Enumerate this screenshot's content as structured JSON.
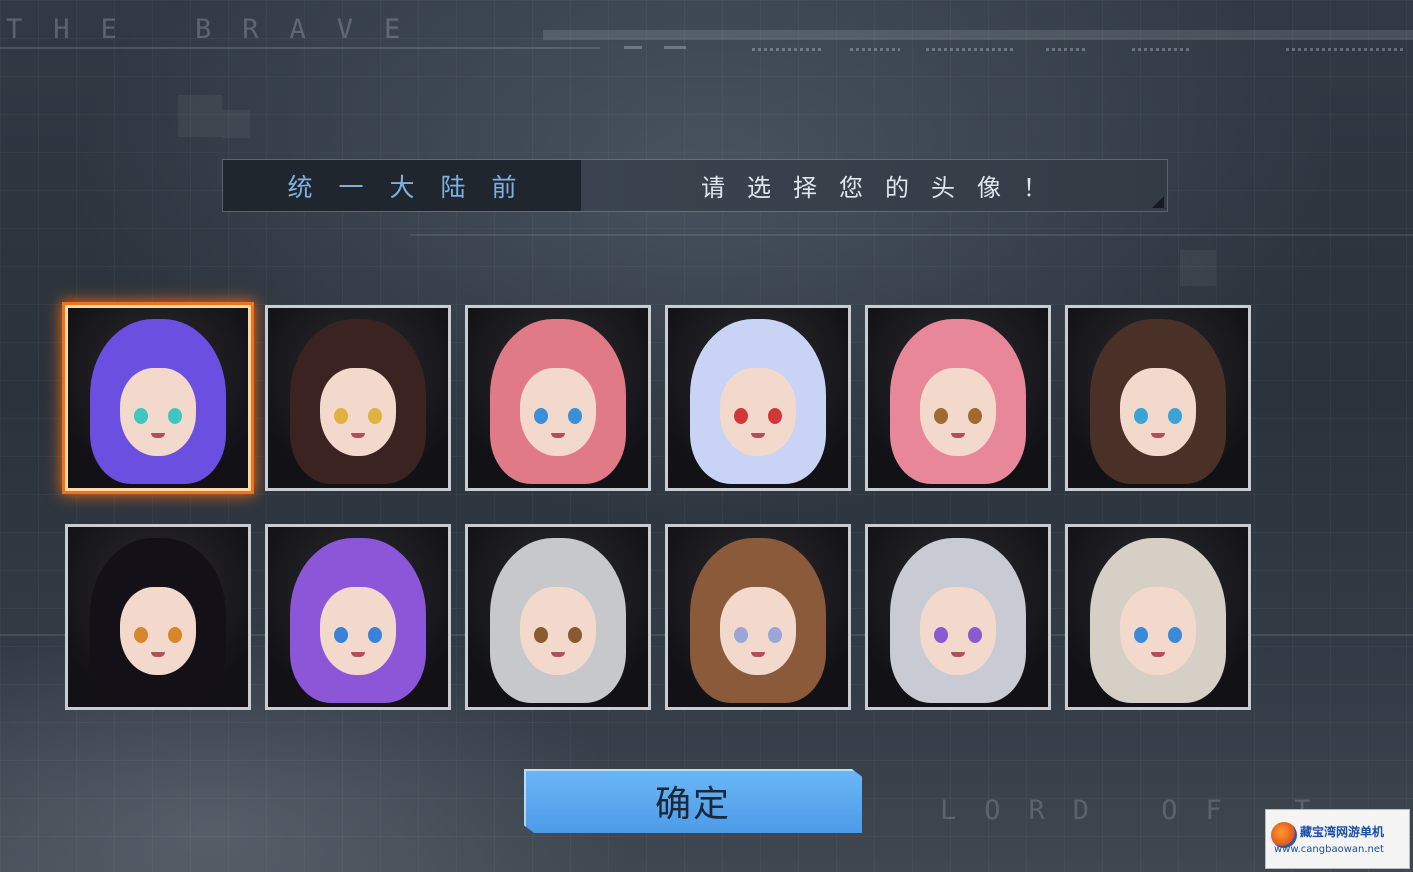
{
  "decor": {
    "brand_top": "THE BRAVE",
    "brand_bottom": "LORD OF T"
  },
  "header": {
    "left_label": "统一大陆前",
    "right_label": "请选择您的头像！"
  },
  "avatars": [
    {
      "id": 1,
      "selected": true,
      "hair": "#6a4fe0",
      "eyes": "#3fc6c0"
    },
    {
      "id": 2,
      "selected": false,
      "hair": "#3a2320",
      "eyes": "#e0b040"
    },
    {
      "id": 3,
      "selected": false,
      "hair": "#e07a86",
      "eyes": "#3a90d8"
    },
    {
      "id": 4,
      "selected": false,
      "hair": "#c9d3f5",
      "eyes": "#d33838"
    },
    {
      "id": 5,
      "selected": false,
      "hair": "#e8869a",
      "eyes": "#a06a30"
    },
    {
      "id": 6,
      "selected": false,
      "hair": "#4a3128",
      "eyes": "#3aa4d8"
    },
    {
      "id": 7,
      "selected": false,
      "hair": "#141018",
      "eyes": "#d8862a"
    },
    {
      "id": 8,
      "selected": false,
      "hair": "#8b57d8",
      "eyes": "#3a82d8"
    },
    {
      "id": 9,
      "selected": false,
      "hair": "#c6c8cc",
      "eyes": "#8a5a30"
    },
    {
      "id": 10,
      "selected": false,
      "hair": "#8a5a3a",
      "eyes": "#9aa6d8"
    },
    {
      "id": 11,
      "selected": false,
      "hair": "#c8cad4",
      "eyes": "#8a5ad0"
    },
    {
      "id": 12,
      "selected": false,
      "hair": "#d6cfc6",
      "eyes": "#3a8ad8"
    }
  ],
  "confirm_label": "确定",
  "watermark": {
    "title": "藏宝湾网游单机",
    "url": "www.cangbaowan.net"
  }
}
